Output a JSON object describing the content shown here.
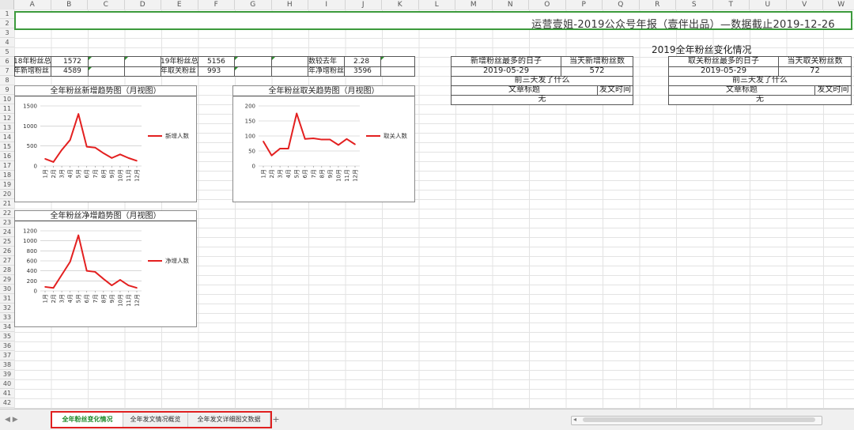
{
  "columns": [
    "A",
    "B",
    "C",
    "D",
    "E",
    "F",
    "G",
    "H",
    "I",
    "J",
    "K",
    "L",
    "M",
    "N",
    "O",
    "P",
    "Q",
    "R",
    "S",
    "T",
    "U",
    "V",
    "W"
  ],
  "rows": [
    "1",
    "2",
    "3",
    "4",
    "5",
    "6",
    "7",
    "8",
    "9",
    "10",
    "11",
    "12",
    "13",
    "14",
    "15",
    "16",
    "17",
    "18",
    "19",
    "20",
    "21",
    "22",
    "23",
    "24",
    "25",
    "26",
    "27",
    "28",
    "29",
    "30",
    "31",
    "32",
    "33",
    "34",
    "35",
    "36",
    "37",
    "38",
    "39",
    "40",
    "41",
    "42"
  ],
  "title": "运营壹姐-2019公众号年报（壹伴出品）—数据截止2019-12-26",
  "section_title": "2019全年粉丝变化情况",
  "stats": {
    "r1": {
      "l1": "18年粉丝总",
      "v1": "1572",
      "l2": "19年粉丝总",
      "v2": "5156",
      "l3": "数较去年",
      "v3": "2.28"
    },
    "r2": {
      "l1": "年新增粉丝",
      "v1": "4589",
      "l2": "年取关粉丝",
      "v2": "993",
      "l3": "年净增粉丝",
      "v3": "3596"
    }
  },
  "table_new": {
    "h1": "新增粉丝最多的日子",
    "h2": "当天新增粉丝数",
    "date": "2019-05-29",
    "count": "572",
    "sub": "前三天发了什么",
    "c1": "文章标题",
    "c2": "发文时间",
    "none": "无"
  },
  "table_unfollow": {
    "h1": "取关粉丝最多的日子",
    "h2": "当天取关粉丝数",
    "date": "2019-05-29",
    "count": "72",
    "sub": "前三天发了什么",
    "c1": "文章标题",
    "c2": "发文时间",
    "none": "无"
  },
  "chart_data": [
    {
      "type": "line",
      "title": "全年粉丝新增趋势图（月视图）",
      "categories": [
        "1月",
        "2月",
        "3月",
        "4月",
        "5月",
        "6月",
        "7月",
        "8月",
        "9月",
        "10月",
        "11月",
        "12月"
      ],
      "series": [
        {
          "name": "新增人数",
          "values": [
            180,
            100,
            400,
            650,
            1300,
            480,
            460,
            320,
            200,
            290,
            200,
            130
          ],
          "color": "#e32020"
        }
      ],
      "ylim": [
        0,
        1500
      ],
      "yticks": [
        "0",
        "500",
        "1000",
        "1500"
      ],
      "legend": "right"
    },
    {
      "type": "line",
      "title": "全年粉丝取关趋势图（月视图）",
      "categories": [
        "1月",
        "2月",
        "3月",
        "4月",
        "5月",
        "6月",
        "7月",
        "8月",
        "9月",
        "10月",
        "11月",
        "12月"
      ],
      "series": [
        {
          "name": "取关人数",
          "values": [
            82,
            35,
            58,
            58,
            175,
            90,
            92,
            88,
            88,
            70,
            90,
            72
          ],
          "color": "#e32020"
        }
      ],
      "ylim": [
        0,
        200
      ],
      "yticks": [
        "0",
        "50",
        "100",
        "150",
        "200"
      ],
      "legend": "right"
    },
    {
      "type": "line",
      "title": "全年粉丝净增趋势图（月视图）",
      "categories": [
        "1月",
        "2月",
        "3月",
        "4月",
        "5月",
        "6月",
        "7月",
        "8月",
        "9月",
        "10月",
        "11月",
        "12月"
      ],
      "series": [
        {
          "name": "净增人数",
          "values": [
            80,
            60,
            320,
            580,
            1110,
            400,
            380,
            240,
            110,
            220,
            110,
            60
          ],
          "color": "#e32020"
        }
      ],
      "ylim": [
        0,
        1200
      ],
      "yticks": [
        "0",
        "200",
        "400",
        "600",
        "800",
        "1000",
        "1200"
      ],
      "legend": "right"
    }
  ],
  "tabs": [
    {
      "label": "全年粉丝变化情况",
      "active": true
    },
    {
      "label": "全年发文情况概览",
      "active": false
    },
    {
      "label": "全年发文详细图文数据",
      "active": false
    }
  ],
  "add_sheet": "+"
}
